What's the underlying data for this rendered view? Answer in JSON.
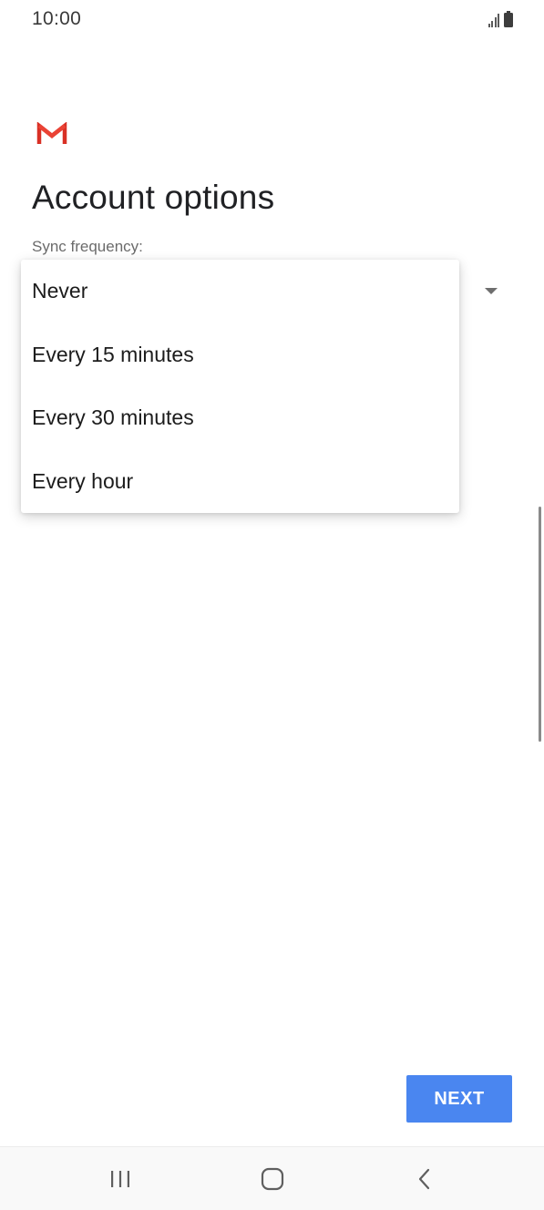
{
  "status_bar": {
    "time": "10:00",
    "signal_icon": "signal-icon",
    "battery_icon": "battery-icon"
  },
  "header": {
    "logo_icon": "gmail-logo-icon",
    "title": "Account options"
  },
  "form": {
    "sync_label": "Sync frequency:"
  },
  "dropdown": {
    "options": [
      {
        "label": "Never"
      },
      {
        "label": "Every 15 minutes"
      },
      {
        "label": "Every 30 minutes"
      },
      {
        "label": "Every hour"
      }
    ]
  },
  "actions": {
    "next_label": "NEXT"
  },
  "colors": {
    "accent": "#4a86f0",
    "gmail_red": "#d93025"
  },
  "nav_bar": {
    "recents_icon": "recents-icon",
    "home_icon": "home-icon",
    "back_icon": "back-icon"
  }
}
